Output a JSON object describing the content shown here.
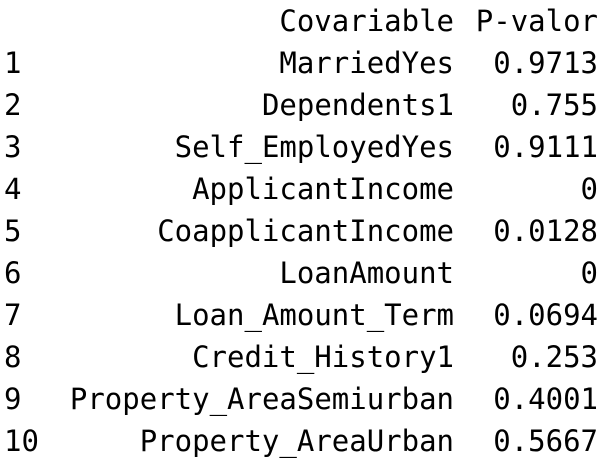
{
  "table": {
    "columns": [
      "Covariable",
      "P-valor"
    ],
    "rows": [
      {
        "index": "1",
        "covariable": "MarriedYes",
        "p_valor": "0.9713"
      },
      {
        "index": "2",
        "covariable": "Dependents1",
        "p_valor": "0.755"
      },
      {
        "index": "3",
        "covariable": "Self_EmployedYes",
        "p_valor": "0.9111"
      },
      {
        "index": "4",
        "covariable": "ApplicantIncome",
        "p_valor": "0"
      },
      {
        "index": "5",
        "covariable": "CoapplicantIncome",
        "p_valor": "0.0128"
      },
      {
        "index": "6",
        "covariable": "LoanAmount",
        "p_valor": "0"
      },
      {
        "index": "7",
        "covariable": "Loan_Amount_Term",
        "p_valor": "0.0694"
      },
      {
        "index": "8",
        "covariable": "Credit_History1",
        "p_valor": "0.253"
      },
      {
        "index": "9",
        "covariable": "Property_AreaSemiurban",
        "p_valor": "0.4001"
      },
      {
        "index": "10",
        "covariable": "Property_AreaUrban",
        "p_valor": "0.5667"
      }
    ]
  }
}
